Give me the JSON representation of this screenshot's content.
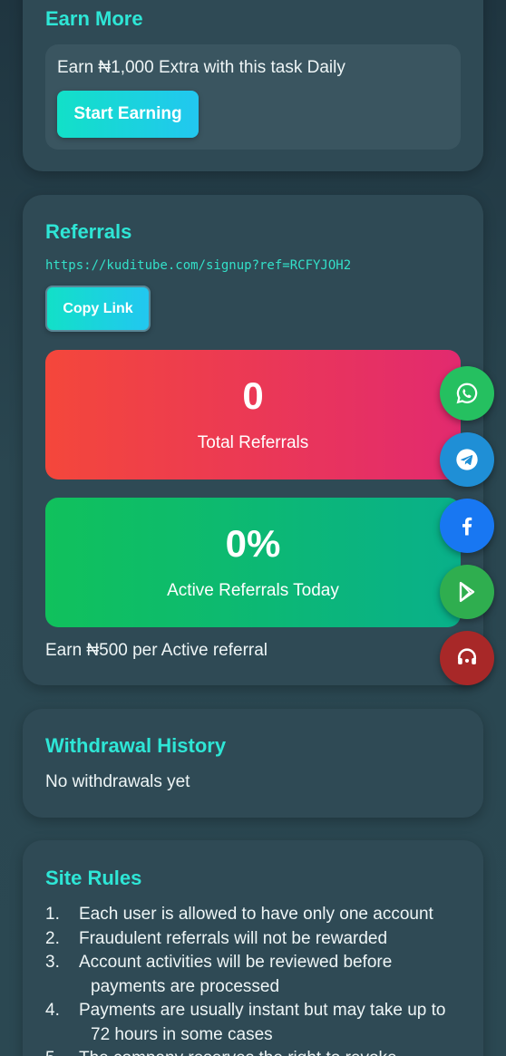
{
  "earn_more": {
    "title": "Earn More",
    "text": "Earn ₦1,000 Extra with this task Daily",
    "button": "Start Earning"
  },
  "referrals": {
    "title": "Referrals",
    "link": "https://kuditube.com/signup?ref=RCFYJOH2",
    "copy_button": "Copy Link",
    "total_value": "0",
    "total_label": "Total Referrals",
    "active_value": "0%",
    "active_label": "Active Referrals Today",
    "earn_per": "Earn ₦500 per Active referral"
  },
  "withdrawal": {
    "title": "Withdrawal History",
    "empty": "No withdrawals yet"
  },
  "rules": {
    "title": "Site Rules",
    "items": [
      {
        "num": "1.",
        "text": "Each user is allowed to have only one account"
      },
      {
        "num": "2.",
        "text": "Fraudulent referrals will not be rewarded"
      },
      {
        "num": "3.",
        "text": "Account activities will be reviewed before payments are processed"
      },
      {
        "num": "4.",
        "text": "Payments are usually instant but may take up to 72 hours in some cases"
      },
      {
        "num": "5.",
        "text": "The company reserves the right to revoke"
      }
    ]
  },
  "floating_buttons": [
    {
      "icon": "whatsapp-icon",
      "color": "#25c060"
    },
    {
      "icon": "telegram-icon",
      "color": "#1f8fd6"
    },
    {
      "icon": "facebook-icon",
      "color": "#1877f2"
    },
    {
      "icon": "play-store-icon",
      "color": "#2fae4f"
    },
    {
      "icon": "headset-icon",
      "color": "#a82828"
    }
  ]
}
